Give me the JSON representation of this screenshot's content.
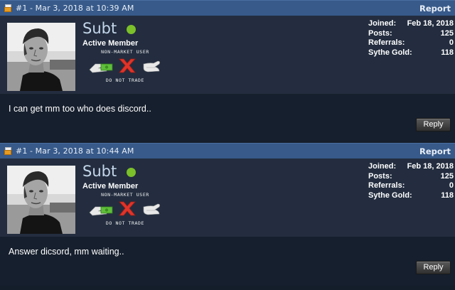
{
  "posts": [
    {
      "meta": "#1 - Mar 3, 2018 at 10:39 AM",
      "report_label": "Report",
      "username": "Subt",
      "user_title": "Active Member",
      "rank_top": "NON-MARKET USER",
      "rank_bottom": "DO NOT TRADE",
      "stats": [
        {
          "label": "Joined:",
          "value": "Feb 18, 2018"
        },
        {
          "label": "Posts:",
          "value": "125"
        },
        {
          "label": "Referrals:",
          "value": "0"
        },
        {
          "label": "Sythe Gold:",
          "value": "118"
        }
      ],
      "message": "I can get mm too who does discord..",
      "reply_label": "Reply"
    },
    {
      "meta": "#1 - Mar 3, 2018 at 10:44 AM",
      "report_label": "Report",
      "username": "Subt",
      "user_title": "Active Member",
      "rank_top": "NON-MARKET USER",
      "rank_bottom": "DO NOT TRADE",
      "stats": [
        {
          "label": "Joined:",
          "value": "Feb 18, 2018"
        },
        {
          "label": "Posts:",
          "value": "125"
        },
        {
          "label": "Referrals:",
          "value": "0"
        },
        {
          "label": "Sythe Gold:",
          "value": "118"
        }
      ],
      "message": "Answer dicsord, mm waiting..",
      "reply_label": "Reply"
    }
  ],
  "colors": {
    "header": "#375a8a",
    "userinfo": "#232d3f",
    "message": "#161f2d",
    "online": "#7cc02a",
    "no_trade": "#e0342a",
    "money": "#5fbf3a"
  },
  "icons": [
    "post-icon",
    "online-indicator-icon",
    "money-hand-icon",
    "no-trade-x-icon",
    "open-hand-icon"
  ]
}
